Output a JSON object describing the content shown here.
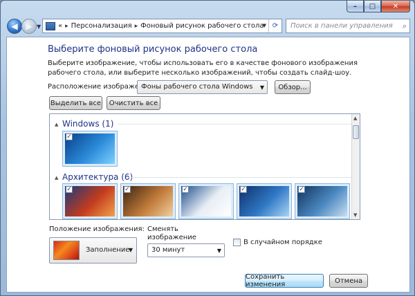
{
  "titlebar": {
    "minimize": "–",
    "maximize": "□",
    "close": "✕"
  },
  "nav": {
    "back": "◀",
    "forward": "▶"
  },
  "address": {
    "prefix": "«",
    "crumbs": [
      "Персонализация",
      "Фоновый рисунок рабочего стола"
    ]
  },
  "search": {
    "placeholder": "Поиск в панели управления"
  },
  "main": {
    "heading": "Выберите фоновый рисунок рабочего стола",
    "description": "Выберите изображение, чтобы использовать его в качестве фонового изображения рабочего стола, или выберите несколько изображений, чтобы создать слайд-шоу.",
    "location_label": "Расположение изображения:",
    "location_value": "Фоны рабочего стола Windows",
    "browse_label": "Обзор...",
    "select_all_label": "Выделить все",
    "clear_all_label": "Очистить все"
  },
  "gallery": {
    "groups": [
      {
        "title": "Windows (1)",
        "items": [
          {
            "checked": true,
            "colors": [
              "#0a3f8c",
              "#2a8ad8",
              "#7fd0ff"
            ]
          }
        ]
      },
      {
        "title": "Архитектура (6)",
        "items": [
          {
            "checked": true,
            "colors": [
              "#1b3a7a",
              "#c33b1e",
              "#f2a24a"
            ]
          },
          {
            "checked": true,
            "colors": [
              "#3b2410",
              "#c07a3a",
              "#f0d0a0"
            ]
          },
          {
            "checked": true,
            "colors": [
              "#1d4e8c",
              "#e8eef5",
              "#ffffff"
            ]
          },
          {
            "checked": true,
            "colors": [
              "#0e2f6a",
              "#2f78c4",
              "#a8d4f4"
            ]
          },
          {
            "checked": true,
            "colors": [
              "#12325e",
              "#4a88c0",
              "#c8def0"
            ]
          }
        ]
      }
    ]
  },
  "position": {
    "label": "Положение изображения:",
    "value": "Заполнение"
  },
  "interval": {
    "label": "Сменять изображение каждые:",
    "value": "30 минут"
  },
  "shuffle": {
    "label": "В случайном порядке",
    "checked": false
  },
  "footer": {
    "save_label": "Сохранить изменения",
    "cancel_label": "Отмена"
  }
}
